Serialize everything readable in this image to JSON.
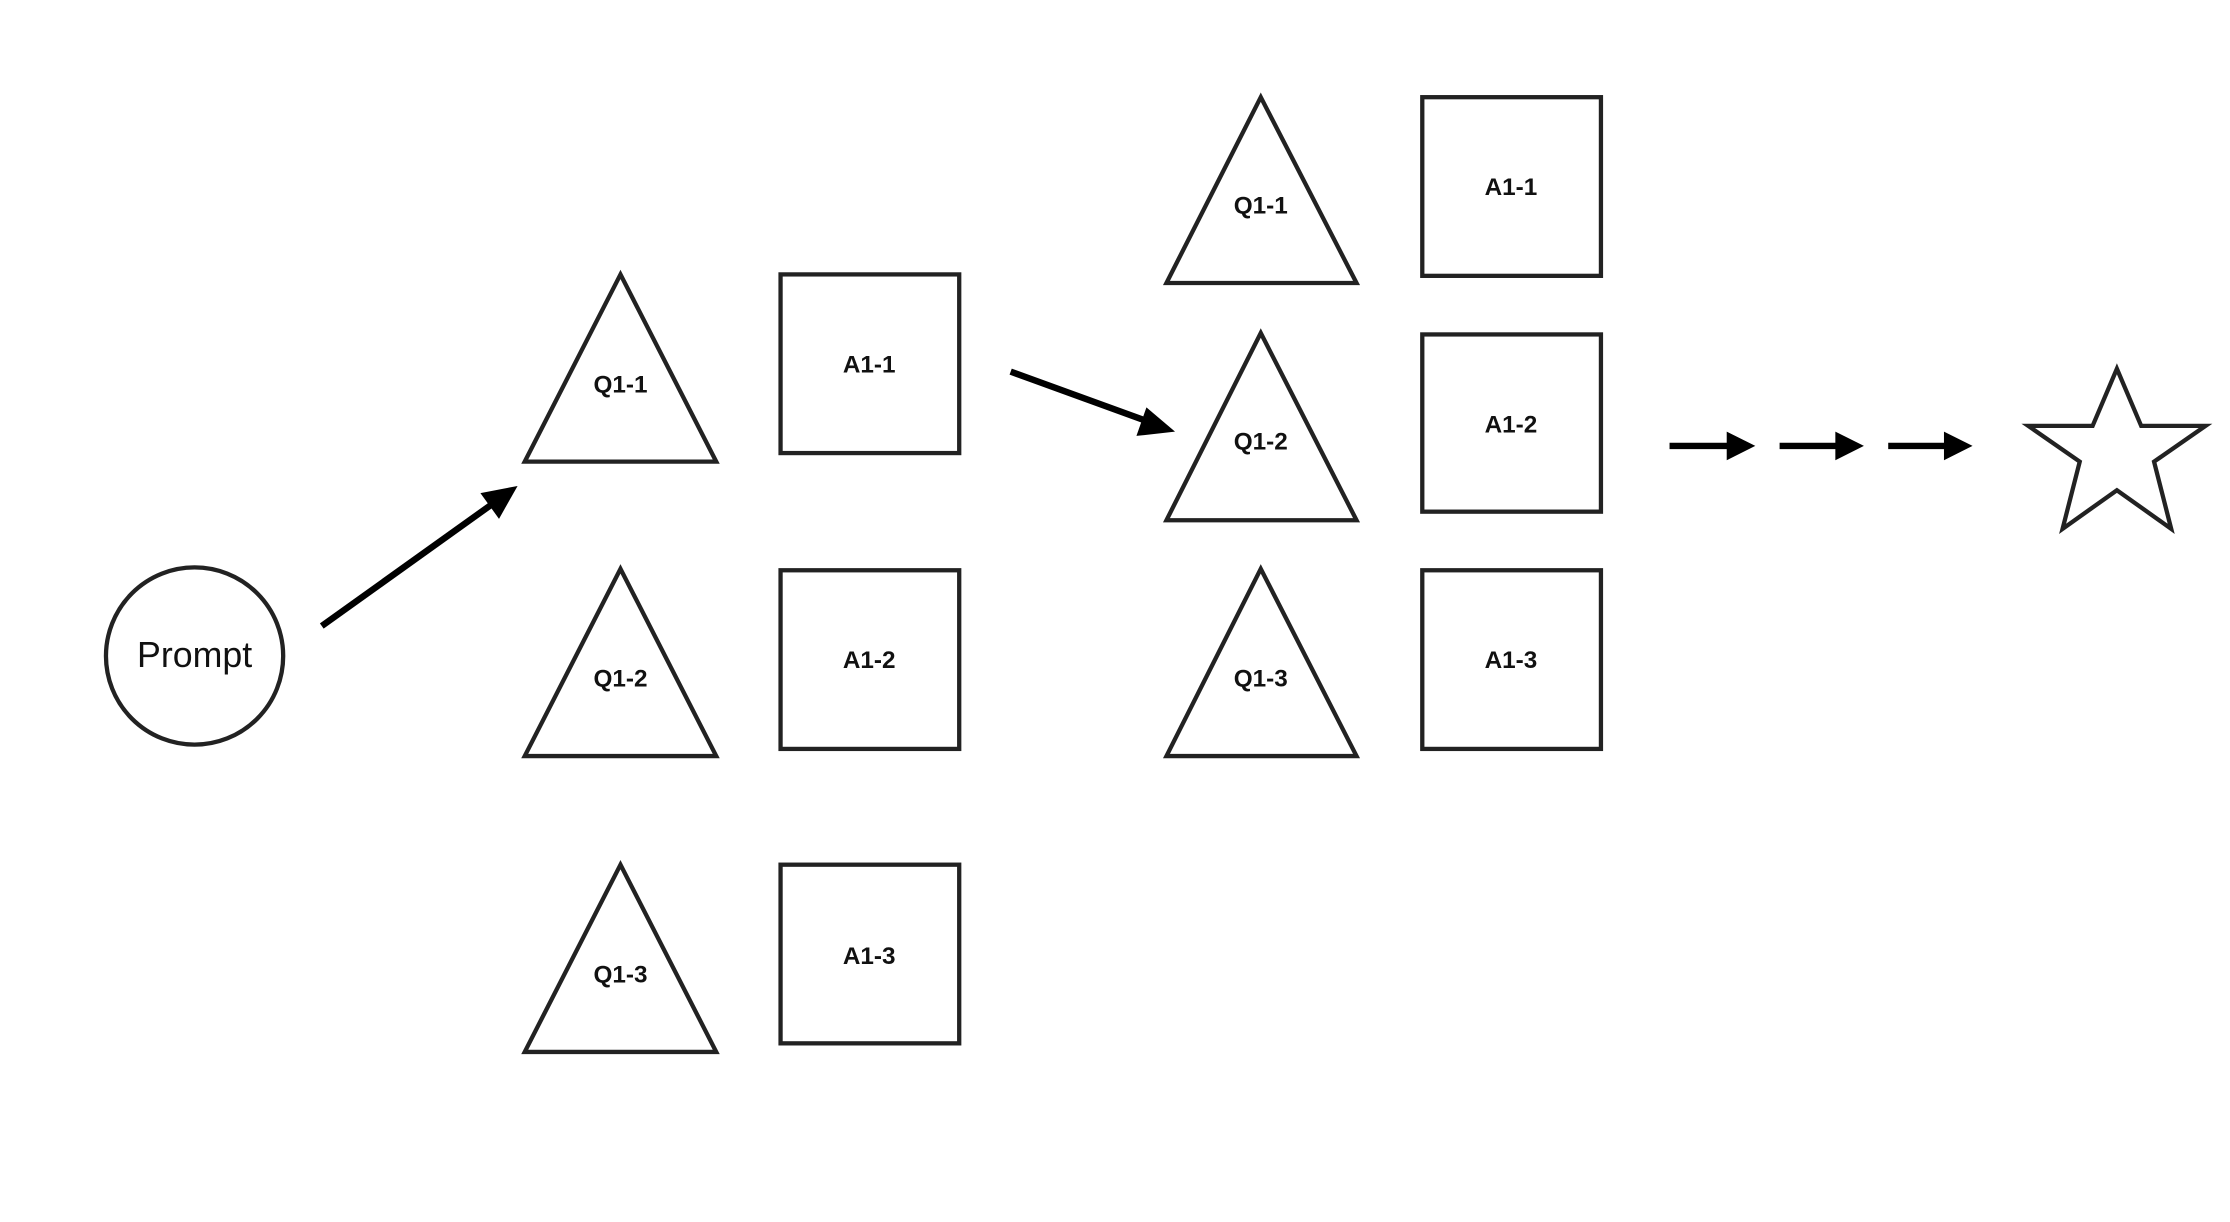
{
  "prompt": {
    "label": "Prompt"
  },
  "stage1": {
    "questions": [
      "Q1-1",
      "Q1-2",
      "Q1-3"
    ],
    "answers": [
      "A1-1",
      "A1-2",
      "A1-3"
    ]
  },
  "stage2": {
    "questions": [
      "Q1-1",
      "Q1-2",
      "Q1-3"
    ],
    "answers": [
      "A1-1",
      "A1-2",
      "A1-3"
    ]
  },
  "goal": {
    "icon": "star-icon"
  },
  "colors": {
    "stroke": "#222222",
    "arrow": "#000000",
    "background": "#ffffff"
  }
}
